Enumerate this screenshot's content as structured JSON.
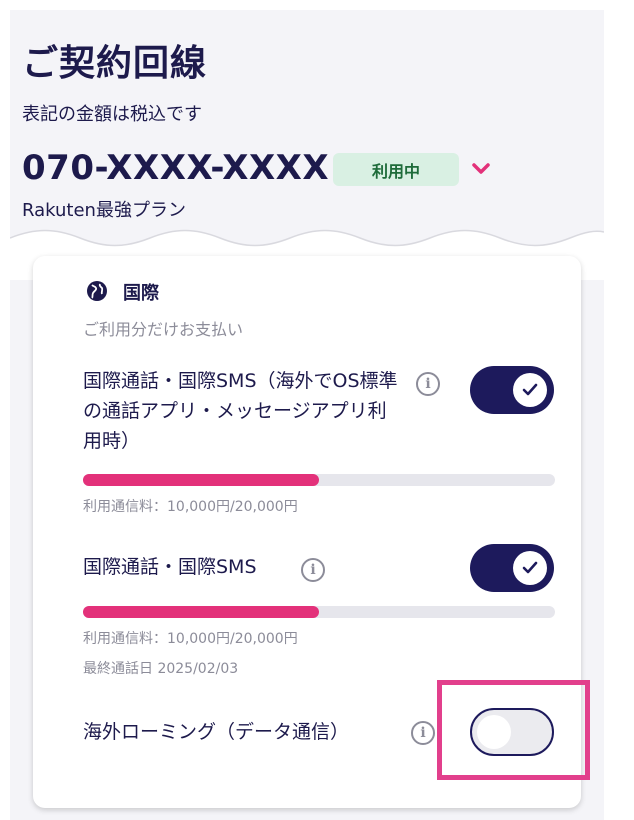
{
  "header": {
    "title": "ご契約回線",
    "subtitle": "表記の金額は税込です",
    "phone_number": "070-XXXX-XXXX",
    "status_badge": "利用中",
    "plan_name": "Rakuten最強プラン"
  },
  "international": {
    "section_title": "国際",
    "section_subtitle": "ご利用分だけお支払い",
    "items": [
      {
        "label": "国際通話・国際SMS（海外でOS標準の通話アプリ・メッセージアプリ利用時）",
        "enabled": true,
        "usage_fraction": 0.5,
        "usage_text": "利用通信料：10,000円/20,000円"
      },
      {
        "label": "国際通話・国際SMS",
        "enabled": true,
        "usage_fraction": 0.5,
        "usage_text": "利用通信料：10,000円/20,000円",
        "last_call": "最終通話日 2025/02/03"
      },
      {
        "label": "海外ローミング（データ通信）",
        "enabled": false
      }
    ]
  },
  "colors": {
    "primary": "#1d1a5c",
    "accent": "#e3317a",
    "badge_bg": "#d9f0e3",
    "highlight": "#e23f8c"
  },
  "icons": {
    "section": "globe-icon",
    "info": "info-icon",
    "dropdown": "chevron-down-icon",
    "toggle_on": "check-icon"
  }
}
